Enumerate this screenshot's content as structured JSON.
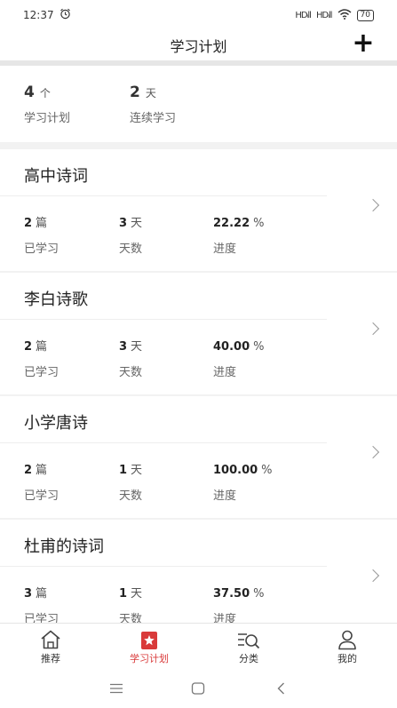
{
  "status_bar": {
    "time": "12:37",
    "signal1": "HDᵢll",
    "signal2": "HDᵢll",
    "battery": "70"
  },
  "header": {
    "title": "学习计划",
    "add_label": "+"
  },
  "summary": {
    "plans_count": "4",
    "plans_unit": "个",
    "plans_label": "学习计划",
    "streak_count": "2",
    "streak_unit": "天",
    "streak_label": "连续学习"
  },
  "plans": [
    {
      "title": "高中诗词",
      "learned": "2",
      "learned_unit": "篇",
      "learned_label": "已学习",
      "days": "3",
      "days_unit": "天",
      "days_label": "天数",
      "progress": "22.22",
      "progress_unit": "%",
      "progress_label": "进度"
    },
    {
      "title": "李白诗歌",
      "learned": "2",
      "learned_unit": "篇",
      "learned_label": "已学习",
      "days": "3",
      "days_unit": "天",
      "days_label": "天数",
      "progress": "40.00",
      "progress_unit": "%",
      "progress_label": "进度"
    },
    {
      "title": "小学唐诗",
      "learned": "2",
      "learned_unit": "篇",
      "learned_label": "已学习",
      "days": "1",
      "days_unit": "天",
      "days_label": "天数",
      "progress": "100.00",
      "progress_unit": "%",
      "progress_label": "进度"
    },
    {
      "title": "杜甫的诗词",
      "learned": "3",
      "learned_unit": "篇",
      "learned_label": "已学习",
      "days": "1",
      "days_unit": "天",
      "days_label": "天数",
      "progress": "37.50",
      "progress_unit": "%",
      "progress_label": "进度"
    }
  ],
  "tabs": [
    {
      "label": "推荐",
      "icon": "home-icon"
    },
    {
      "label": "学习计划",
      "icon": "star-badge-icon",
      "active": true
    },
    {
      "label": "分类",
      "icon": "category-search-icon"
    },
    {
      "label": "我的",
      "icon": "person-icon"
    }
  ],
  "colors": {
    "accent": "#d93a3a",
    "background": "#f2f2f2",
    "card": "#ffffff"
  }
}
